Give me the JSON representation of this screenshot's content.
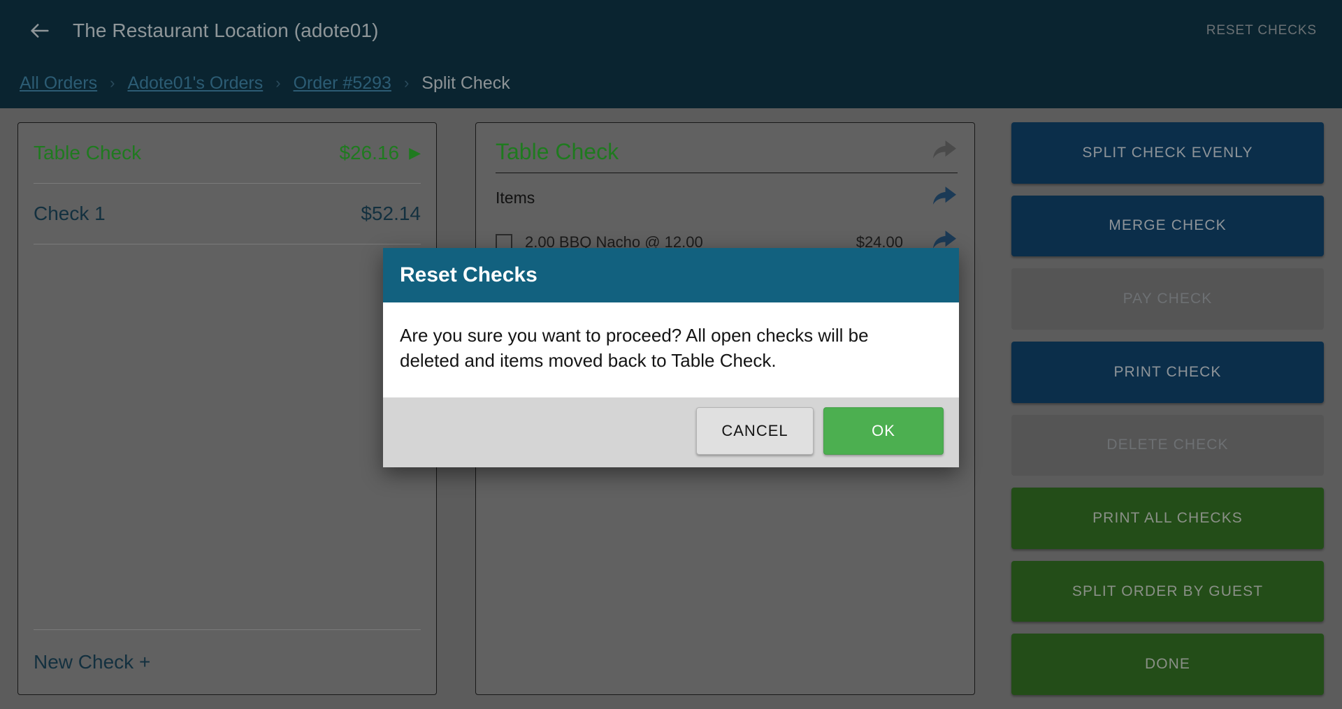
{
  "header": {
    "back_icon": "back-arrow-icon",
    "title": "The Restaurant Location (adote01)",
    "reset_checks_label": "RESET CHECKS",
    "background_color": "#0a2430"
  },
  "breadcrumb": {
    "separator": "›",
    "items": [
      {
        "label": "All Orders",
        "current": false
      },
      {
        "label": "Adote01's Orders",
        "current": false
      },
      {
        "label": "Order #5293",
        "current": false
      },
      {
        "label": "Split Check",
        "current": true
      }
    ]
  },
  "checks_panel": {
    "rows": [
      {
        "name": "Table Check",
        "amount": "$26.16",
        "caret": "▶",
        "selected": true
      },
      {
        "name": "Check 1",
        "amount": "$52.14",
        "caret": "",
        "selected": false
      }
    ],
    "new_check_label": "New Check +"
  },
  "detail_panel": {
    "title": "Table Check",
    "share_icon": "share-forward-icon",
    "items_label": "Items",
    "items_share_icon": "share-forward-icon",
    "line_items": [
      {
        "checkbox_icon": "checkbox-unchecked-icon",
        "text": "2.00 BBQ Nacho @ 12.00",
        "amount": "$24.00",
        "share_icon": "share-forward-icon"
      }
    ]
  },
  "action_rail": {
    "buttons": [
      {
        "label": "SPLIT CHECK EVENLY",
        "style": "navy",
        "enabled": true
      },
      {
        "label": "MERGE CHECK",
        "style": "navy",
        "enabled": true
      },
      {
        "label": "PAY CHECK",
        "style": "disabled",
        "enabled": false
      },
      {
        "label": "PRINT CHECK",
        "style": "navy",
        "enabled": true
      },
      {
        "label": "DELETE CHECK",
        "style": "disabled",
        "enabled": false
      },
      {
        "label": "PRINT ALL CHECKS",
        "style": "green",
        "enabled": true
      },
      {
        "label": "SPLIT ORDER BY GUEST",
        "style": "green",
        "enabled": true
      },
      {
        "label": "DONE",
        "style": "green",
        "enabled": true
      }
    ]
  },
  "dialog": {
    "title": "Reset Checks",
    "message": "Are you sure you want to proceed? All open checks will be deleted and items moved back to Table Check.",
    "cancel_label": "CANCEL",
    "ok_label": "OK",
    "header_color": "#12617f",
    "ok_color": "#4caf50"
  }
}
